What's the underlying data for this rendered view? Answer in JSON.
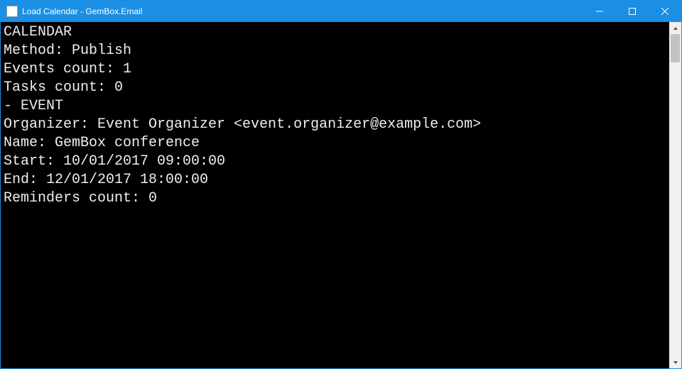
{
  "window": {
    "title": "Load Calendar - GemBox.Email"
  },
  "console": {
    "lines": [
      "CALENDAR",
      "Method: Publish",
      "Events count: 1",
      "Tasks count: 0",
      "",
      "- EVENT",
      "Organizer: Event Organizer <event.organizer@example.com>",
      "Name: GemBox conference",
      "Start: 10/01/2017 09:00:00",
      "End: 12/01/2017 18:00:00",
      "Reminders count: 0"
    ]
  }
}
